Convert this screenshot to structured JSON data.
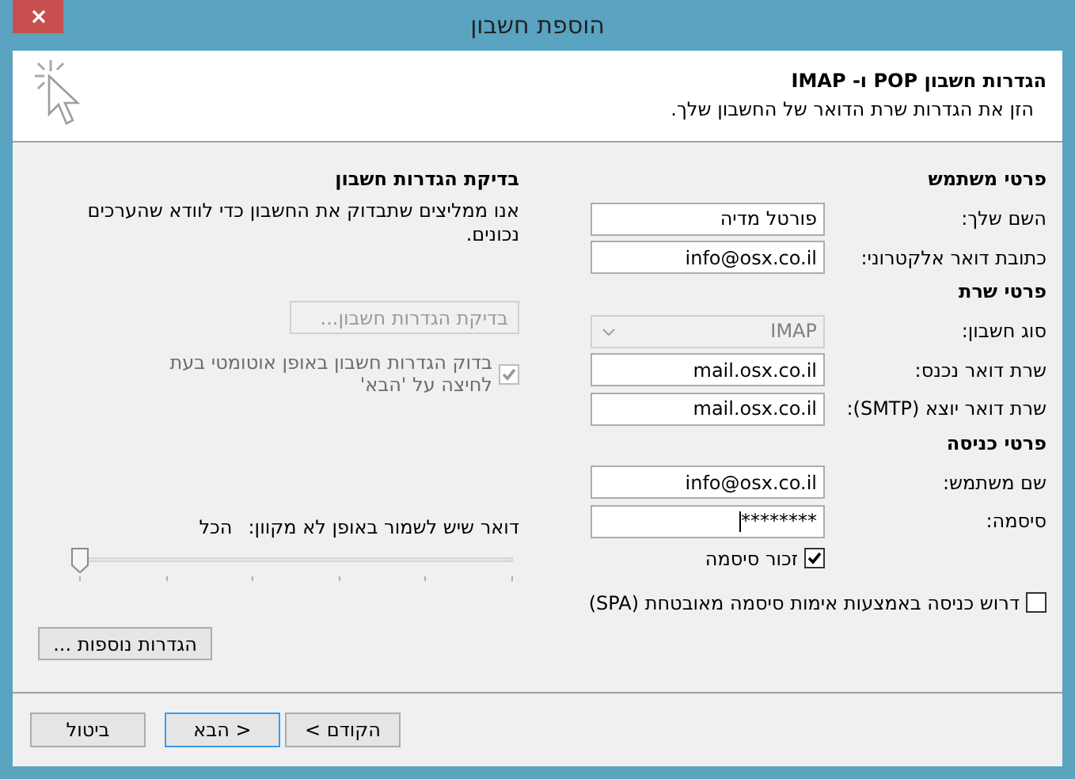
{
  "window": {
    "title": "הוספת חשבון"
  },
  "header": {
    "title": "הגדרות חשבון POP ו- IMAP",
    "subtitle": "הזן את הגדרות שרת הדואר של החשבון שלך."
  },
  "sections": [
    {
      "heading": "פרטי משתמש",
      "fields": [
        {
          "kind": "text",
          "label": "השם שלך:",
          "value": "פורטל מדיה"
        },
        {
          "kind": "text",
          "label": "כתובת דואר אלקטרוני:",
          "value": "info@osx.co.il"
        }
      ]
    },
    {
      "heading": "פרטי שרת",
      "fields": [
        {
          "kind": "select",
          "label": "סוג חשבון:",
          "value": "IMAP",
          "disabled": true
        },
        {
          "kind": "text",
          "label": "שרת דואר נכנס:",
          "value": "mail.osx.co.il"
        },
        {
          "kind": "text",
          "label": "שרת דואר יוצא (SMTP):",
          "value": "mail.osx.co.il"
        }
      ]
    },
    {
      "heading": "פרטי כניסה",
      "fields": [
        {
          "kind": "text",
          "label": "שם משתמש:",
          "value": "info@osx.co.il"
        },
        {
          "kind": "password",
          "label": "סיסמה:",
          "value": "********"
        }
      ]
    }
  ],
  "remember_password": {
    "label": "זכור סיסמה",
    "checked": true
  },
  "spa": {
    "label": "דרוש כניסה באמצעות אימות סיסמה מאובטחת (SPA)",
    "checked": false
  },
  "test": {
    "heading": "בדיקת הגדרות חשבון",
    "description": "אנו ממליצים שתבדוק את החשבון כדי לוודא שהערכים נכונים.",
    "button": {
      "label": "בדיקת הגדרות חשבון...",
      "disabled": true
    },
    "auto_test": {
      "label": "בדוק הגדרות חשבון באופן אוטומטי בעת לחיצה על 'הבא'",
      "checked": true,
      "disabled": true
    }
  },
  "offline": {
    "label": "דואר שיש לשמור באופן לא מקוון:",
    "value": "הכל",
    "level": 0
  },
  "more_settings_button": "הגדרות נוספות ...",
  "footer_buttons": [
    {
      "label": "< הקודם",
      "selected": false
    },
    {
      "label": "הבא >",
      "selected": true
    },
    {
      "label": "ביטול",
      "selected": false
    }
  ]
}
